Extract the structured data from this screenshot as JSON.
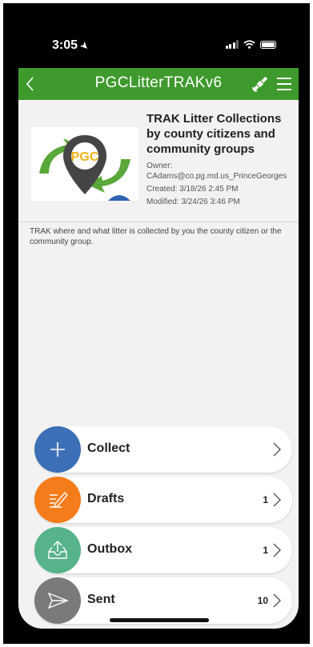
{
  "status": {
    "time": "3:05"
  },
  "appbar": {
    "title": "PGCLitterTRAKv6",
    "back_icon": "chevron-left-icon",
    "gps_icon": "satellite-icon",
    "menu_icon": "hamburger-icon"
  },
  "survey": {
    "logo_text": "PGC",
    "title": "TRAK Litter Collections by county citizens and community groups",
    "owner_label": "Owner:",
    "owner": "CAdams@co.pg.md.us_PrinceGeorges",
    "created": "Created: 3/18/26 2:45 PM",
    "modified": "Modified: 3/24/26 3:46 PM",
    "description": "TRAK where and what litter is collected by you the county citizen or the community group."
  },
  "actions": [
    {
      "label": "Collect",
      "count": "",
      "color": "#3d6fb6",
      "icon": "plus-icon"
    },
    {
      "label": "Drafts",
      "count": "1",
      "color": "#f47c1a",
      "icon": "pencil-note-icon"
    },
    {
      "label": "Outbox",
      "count": "1",
      "color": "#56b38a",
      "icon": "outbox-tray-icon"
    },
    {
      "label": "Sent",
      "count": "10",
      "color": "#7a7a7a",
      "icon": "send-icon"
    }
  ],
  "colors": {
    "appbar": "#3f9a2d",
    "background": "#f2f2f2"
  }
}
